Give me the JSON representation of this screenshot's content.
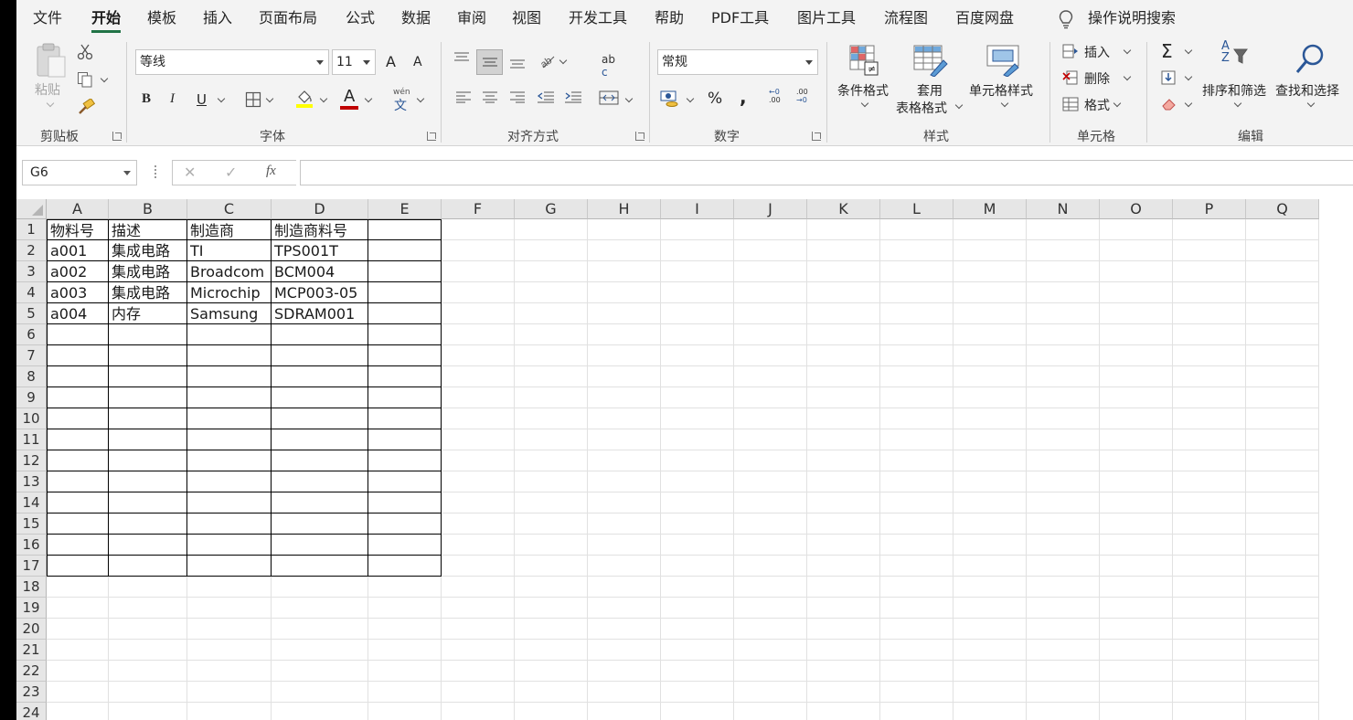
{
  "tabs": [
    "文件",
    "开始",
    "模板",
    "插入",
    "页面布局",
    "公式",
    "数据",
    "审阅",
    "视图",
    "开发工具",
    "帮助",
    "PDF工具",
    "图片工具",
    "流程图",
    "百度网盘"
  ],
  "active_tab": "开始",
  "tell_me": "操作说明搜索",
  "ribbon": {
    "clipboard": {
      "paste": "粘贴",
      "label": "剪贴板"
    },
    "font": {
      "name": "等线",
      "size": "11",
      "grow": "A",
      "shrink": "A",
      "bold": "B",
      "italic": "I",
      "underline": "U",
      "color_letter": "A",
      "wen": "wén",
      "wen_char": "文",
      "label": "字体"
    },
    "alignment": {
      "label": "对齐方式",
      "ab": "ab",
      "c": "c"
    },
    "number": {
      "format": "常规",
      "percent": "%",
      "comma": ",",
      "inc": ".00",
      "dec": ".00",
      "inc_prefix": "←0",
      "dec_prefix": "→0",
      "label": "数字"
    },
    "styles": {
      "conditional": "条件格式",
      "table_line1": "套用",
      "table_line2": "表格格式",
      "cell_styles": "单元格样式",
      "label": "样式"
    },
    "cells": {
      "insert": "插入",
      "delete": "删除",
      "format": "格式",
      "label": "单元格"
    },
    "editing": {
      "sigma": "Σ",
      "sort_a": "A",
      "sort_z": "Z",
      "sort_filter": "排序和筛选",
      "find_select": "查找和选择",
      "label": "编辑"
    }
  },
  "formula_bar": {
    "name_box": "G6",
    "cancel": "✕",
    "enter": "✓",
    "fx": "fx",
    "value": ""
  },
  "columns": [
    "A",
    "B",
    "C",
    "D",
    "E",
    "F",
    "G",
    "H",
    "I",
    "J",
    "K",
    "L",
    "M",
    "N",
    "O",
    "P",
    "Q"
  ],
  "rows": [
    "1",
    "2",
    "3",
    "4",
    "5",
    "6",
    "7",
    "8",
    "9",
    "10",
    "11",
    "12",
    "13",
    "14",
    "15",
    "16",
    "17",
    "18",
    "19",
    "20",
    "21",
    "22",
    "23",
    "24"
  ],
  "sheet": {
    "data": [
      [
        "物料号",
        "描述",
        "制造商",
        "制造商料号",
        ""
      ],
      [
        "a001",
        "集成电路",
        "TI",
        "TPS001T",
        ""
      ],
      [
        "a002",
        "集成电路",
        "Broadcom",
        "BCM004",
        ""
      ],
      [
        "a003",
        "集成电路",
        "Microchip",
        "MCP003-05",
        ""
      ],
      [
        "a004",
        "内存",
        "Samsung",
        "SDRAM001",
        ""
      ]
    ],
    "bordered_rows": 17,
    "bordered_cols": 5
  },
  "colors": {
    "accent": "#217346",
    "ribbon_bg": "#f3f3f3",
    "header_bg": "#e6e6e6"
  }
}
